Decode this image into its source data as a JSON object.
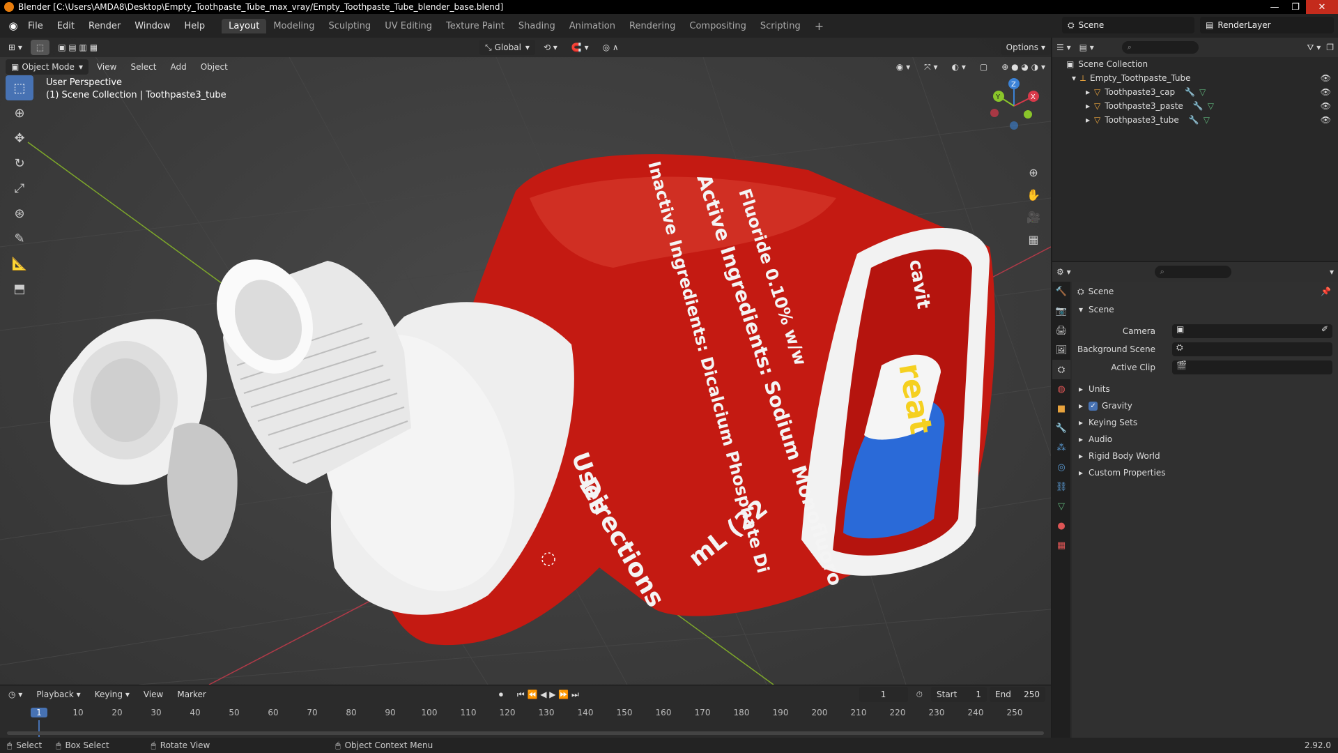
{
  "window": {
    "title": "Blender [C:\\Users\\AMDA8\\Desktop\\Empty_Toothpaste_Tube_max_vray/Empty_Toothpaste_Tube_blender_base.blend]",
    "controls": [
      "—",
      "❐",
      "✕"
    ]
  },
  "menu": [
    "File",
    "Edit",
    "Render",
    "Window",
    "Help"
  ],
  "workspaces": [
    "Layout",
    "Modeling",
    "Sculpting",
    "UV Editing",
    "Texture Paint",
    "Shading",
    "Animation",
    "Rendering",
    "Compositing",
    "Scripting"
  ],
  "add_workspace": "+",
  "scene_selector": "Scene",
  "renderlayer_selector": "RenderLayer",
  "tool_header": {
    "orientation": "Global",
    "options": "Options"
  },
  "viewport_header": {
    "mode": "Object Mode",
    "menus": [
      "View",
      "Select",
      "Add",
      "Object"
    ]
  },
  "viewport_overlay": {
    "line1": "User Perspective",
    "line2": "(1) Scene Collection | Toothpaste3_tube"
  },
  "gizmo": {
    "x": "X",
    "y": "Y",
    "z": "Z"
  },
  "texture_text": {
    "a": "Active Ingredients: Sodium Monofluoro",
    "b": "Inactive Ingredients: Dicalcium Phosphate Di",
    "c": "Fluoride 0.10% w/w",
    "d": "Directions",
    "e": "mL (22",
    "f": "Uses",
    "g": "cavit",
    "h": "reat"
  },
  "outliner": {
    "root": "Scene Collection",
    "parent": "Empty_Toothpaste_Tube",
    "children": [
      "Toothpaste3_cap",
      "Toothpaste3_paste",
      "Toothpaste3_tube"
    ]
  },
  "properties": {
    "context": "Scene",
    "panel": "Scene",
    "fields": [
      {
        "label": "Camera",
        "value": ""
      },
      {
        "label": "Background Scene",
        "value": ""
      },
      {
        "label": "Active Clip",
        "value": ""
      }
    ],
    "subpanels": [
      "Units",
      "Gravity",
      "Keying Sets",
      "Audio",
      "Rigid Body World",
      "Custom Properties"
    ],
    "gravity_checked": true
  },
  "timeline": {
    "menus": [
      "Playback",
      "Keying",
      "View",
      "Marker"
    ],
    "current_frame": "1",
    "start_label": "Start",
    "start": "1",
    "end_label": "End",
    "end": "250",
    "ticks": [
      "1",
      "10",
      "20",
      "30",
      "40",
      "50",
      "60",
      "70",
      "80",
      "90",
      "100",
      "110",
      "120",
      "130",
      "140",
      "150",
      "160",
      "170",
      "180",
      "190",
      "200",
      "210",
      "220",
      "230",
      "240",
      "250"
    ]
  },
  "statusbar": {
    "select": "Select",
    "box_select": "Box Select",
    "rotate": "Rotate View",
    "context_menu": "Object Context Menu",
    "version": "2.92.0"
  },
  "colors": {
    "accent": "#4772b3",
    "tube_red": "#c41a12",
    "x_axis": "#d8394a",
    "y_axis": "#8ac52a",
    "z_axis": "#3b82d6"
  }
}
